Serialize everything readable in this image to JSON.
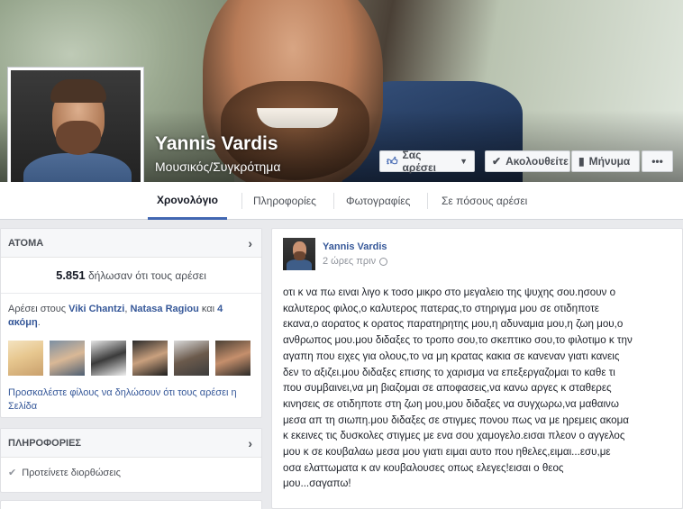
{
  "profile": {
    "name": "Yannis Vardis",
    "category": "Μουσικός/Συγκρότημα"
  },
  "actions": {
    "like_label": "Σας αρέσει",
    "follow_label": "Ακολουθείτε",
    "message_label": "Μήνυμα",
    "more_label": "•••"
  },
  "tabs": [
    {
      "label": "Χρονολόγιο",
      "active": true
    },
    {
      "label": "Πληροφορίες",
      "active": false
    },
    {
      "label": "Φωτογραφίες",
      "active": false
    },
    {
      "label": "Σε πόσους αρέσει",
      "active": false
    }
  ],
  "people_card": {
    "title": "ΑΤΟΜΑ",
    "likes_number": "5.851",
    "likes_suffix": " δήλωσαν ότι τους αρέσει",
    "friends_prefix": "Αρέσει στους ",
    "friend1": "Viki Chantzi",
    "sep": ", ",
    "friend2": "Natasa Ragiou",
    "and": " και ",
    "more": "4 ακόμη",
    "end": ".",
    "invite_text": "Προσκαλέστε φίλους να δηλώσουν ότι τους αρέσει η Σελίδα"
  },
  "info_card": {
    "title": "ΠΛΗΡΟΦΟΡΙΕΣ",
    "suggest_label": "Προτείνετε διορθώσεις"
  },
  "post": {
    "author": "Yannis Vardis",
    "time": "2 ώρες πριν",
    "lines": [
      "οτι κ να πω ειναι λιγο κ τοσο μικρο στο μεγαλειο της ψυχης σου.ησουν ο",
      "καλυτερος φιλος,ο καλυτερος πατερας,το στηριγμα μου σε οτιδηποτε",
      "εκανα,ο αορατος κ ορατος παρατηρητης μου,η αδυναμια μου,η ζωη μου,ο",
      "ανθρωπος μου.μου διδαξες το τροπο σου,το σκεπτικο σου,το φιλοτιμο κ την",
      "αγαπη που ειχες για ολους,το να μη κρατας κακια σε κανεναν γιατι κανεις",
      "δεν το αξιζει.μου διδαξες επισης το χαρισμα να επεξεργαζομαι το καθε τι",
      "που συμβαινει,να μη βιαζομαι σε αποφασεις,να κανω αργες κ σταθερες",
      "κινησεις σε οτιδηποτε στη ζωη μου,μου διδαξες να συγχωρω,να μαθαινω",
      "μεσα απ τη σιωπη.μου διδαξες σε στιγμες πονου πως να με ηρεμεις ακομα",
      "κ εκεινες τις δυσκολες στιγμες με ενα σου χαμογελο.εισαι πλεον ο αγγελος",
      "μου κ σε κουβαλαω μεσα μου γιατι ειμαι αυτο που ηθελες,ειμαι...εσυ,με",
      "οσα ελαττωματα κ αν κουβαλουσες οπως ελεγες!εισαι ο θεος",
      "μου...σαγαπω!"
    ]
  },
  "colors": {
    "link": "#365899",
    "accent": "#4267b2",
    "background": "#e9eaed"
  }
}
